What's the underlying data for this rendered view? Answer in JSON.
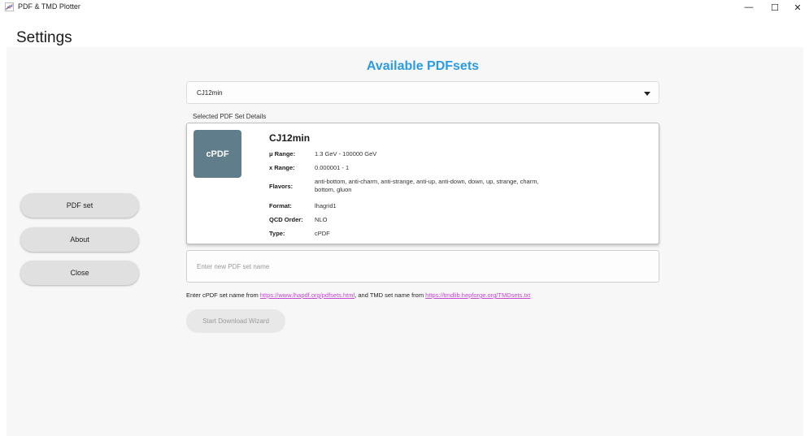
{
  "window": {
    "title": "PDF & TMD Plotter",
    "controls": {
      "minimize": "—",
      "maximize": "☐",
      "close": "✕"
    },
    "icon": "app-chart-icon"
  },
  "page": {
    "heading": "Settings"
  },
  "sidebar": {
    "items": [
      {
        "label": "PDF set"
      },
      {
        "label": "About"
      },
      {
        "label": "Close"
      }
    ]
  },
  "main": {
    "title": "Available PDFsets",
    "select": {
      "value": "CJ12min",
      "icon": "chevron-down-icon"
    },
    "details_label": "Selected PDF Set Details",
    "card": {
      "badge": "cPDF",
      "name": "CJ12min",
      "mu_range": {
        "label": "μ Range:",
        "value": "1.3 GeV - 100000 GeV"
      },
      "x_range": {
        "label": "x Range:",
        "value": "0.000001 - 1"
      },
      "flavors": {
        "label": "Flavors:",
        "value": "anti-bottom, anti-charm, anti-strange, anti-up, anti-down, down, up, strange, charm, bottom, gluon"
      },
      "format": {
        "label": "Format:",
        "value": "lhagrid1"
      },
      "qcd_order": {
        "label": "QCD Order:",
        "value": "NLO"
      },
      "type": {
        "label": "Type:",
        "value": "cPDF"
      }
    },
    "input": {
      "placeholder": "Enter new PDF set name",
      "value": ""
    },
    "hint": {
      "prefix": "Enter cPDF set name from ",
      "link1": "https://www.lhapdf.org/pdfsets.html",
      "middle": ", and TMD set name from ",
      "link2": "https://tmdlib.hepforge.org/TMDsets.txt"
    },
    "wizard_button": "Start Download Wizard"
  },
  "colors": {
    "accent": "#2b9be3",
    "badge": "#5f7d8a",
    "link": "#c547d1"
  }
}
